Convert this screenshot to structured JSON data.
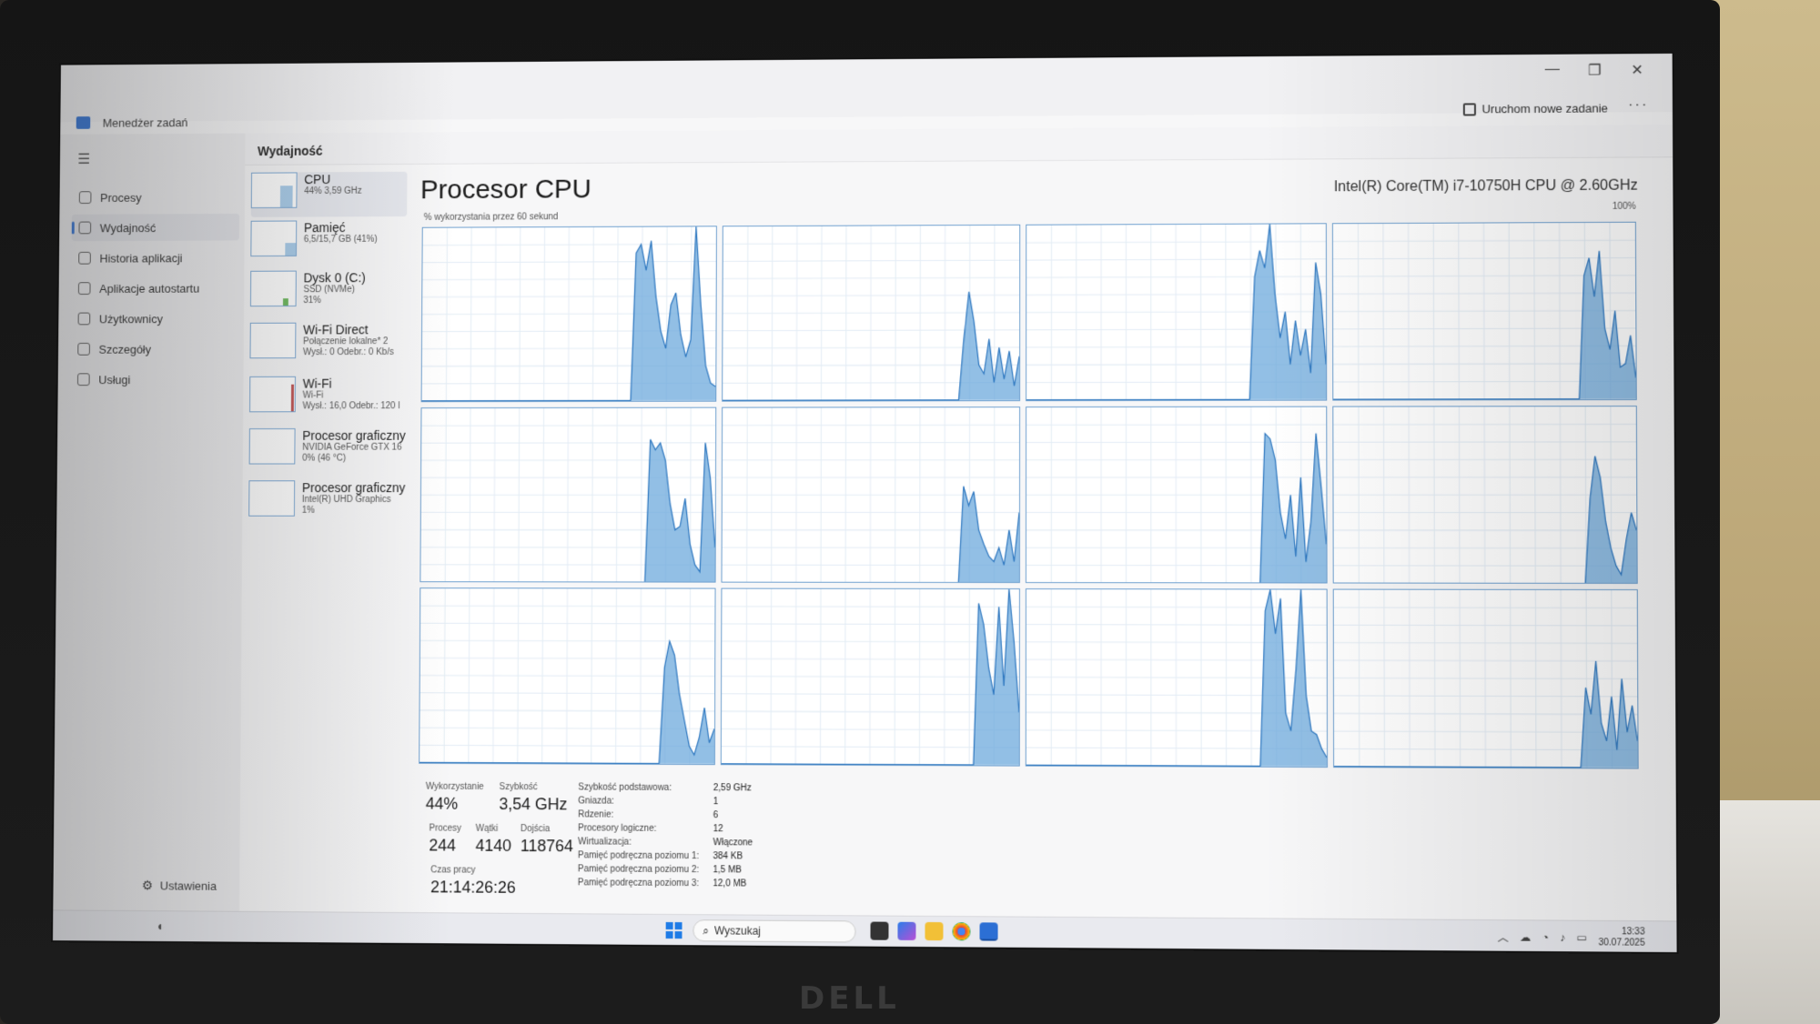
{
  "window": {
    "title": "Menedżer zadań",
    "run_new_task": "Uruchom nowe zadanie",
    "more": "···"
  },
  "nav": {
    "items": [
      {
        "label": "Procesy",
        "icon": "processes-icon",
        "active": false
      },
      {
        "label": "Wydajność",
        "icon": "performance-icon",
        "active": true
      },
      {
        "label": "Historia aplikacji",
        "icon": "history-icon",
        "active": false
      },
      {
        "label": "Aplikacje autostartu",
        "icon": "startup-icon",
        "active": false
      },
      {
        "label": "Użytkownicy",
        "icon": "users-icon",
        "active": false
      },
      {
        "label": "Szczegóły",
        "icon": "details-icon",
        "active": false
      },
      {
        "label": "Usługi",
        "icon": "services-icon",
        "active": false
      }
    ],
    "settings": "Ustawienia"
  },
  "page": {
    "title": "Wydajność"
  },
  "devices": [
    {
      "name": "CPU",
      "sub1": "44% 3,59 GHz",
      "sub2": "",
      "sub3": "",
      "active": true
    },
    {
      "name": "Pamięć",
      "sub1": "6,5/15,7 GB (41%)",
      "sub2": "",
      "sub3": "",
      "active": false
    },
    {
      "name": "Dysk 0 (C:)",
      "sub1": "SSD (NVMe)",
      "sub2": "31%",
      "sub3": "",
      "active": false
    },
    {
      "name": "Wi-Fi Direct",
      "sub1": "Połączenie lokalne* 2",
      "sub2": "Wysł.: 0 Odebr.: 0 Kb/s",
      "sub3": "",
      "active": false
    },
    {
      "name": "Wi-Fi",
      "sub1": "Wi-Fi",
      "sub2": "Wysł.: 16,0 Odebr.: 120 l",
      "sub3": "",
      "active": false
    },
    {
      "name": "Procesor graficzny",
      "sub1": "NVIDIA GeForce GTX 16",
      "sub2": "0% (46 °C)",
      "sub3": "",
      "active": false
    },
    {
      "name": "Procesor graficzny",
      "sub1": "Intel(R) UHD Graphics",
      "sub2": "1%",
      "sub3": "",
      "active": false
    }
  ],
  "cpu": {
    "title": "Procesor CPU",
    "model": "Intel(R) Core(TM) i7-10750H CPU @ 2.60GHz",
    "chart_label": "% wykorzystania przez 60 sekund",
    "chart_max": "100%",
    "stats": {
      "usage_label": "Wykorzystanie",
      "usage": "44%",
      "speed_label": "Szybkość",
      "speed": "3,54 GHz",
      "processes_label": "Procesy",
      "processes": "244",
      "threads_label": "Wątki",
      "threads": "4140",
      "handles_label": "Dojścia",
      "handles": "118764",
      "uptime_label": "Czas pracy",
      "uptime": "21:14:26:26"
    },
    "info": [
      {
        "key": "Szybkość podstawowa:",
        "value": "2,59 GHz"
      },
      {
        "key": "Gniazda:",
        "value": "1"
      },
      {
        "key": "Rdzenie:",
        "value": "6"
      },
      {
        "key": "Procesory logiczne:",
        "value": "12"
      },
      {
        "key": "Wirtualizacja:",
        "value": "Włączone"
      },
      {
        "key": "Pamięć podręczna poziomu 1:",
        "value": "384 KB"
      },
      {
        "key": "Pamięć podręczna poziomu 2:",
        "value": "1,5 MB"
      },
      {
        "key": "Pamięć podręczna poziomu 3:",
        "value": "12,0 MB"
      }
    ]
  },
  "chart_data": {
    "type": "area",
    "title": "",
    "xlabel": "",
    "ylabel": "% wykorzystania przez 60 sekund",
    "ylim": [
      0,
      100
    ],
    "xlim": [
      0,
      60
    ],
    "grid": true,
    "series": [
      {
        "values": [
          0,
          0,
          0,
          0,
          0,
          0,
          0,
          0,
          0,
          0,
          0,
          0,
          0,
          0,
          0,
          0,
          0,
          0,
          0,
          0,
          0,
          0,
          0,
          0,
          0,
          0,
          0,
          0,
          0,
          0,
          0,
          0,
          0,
          0,
          0,
          0,
          0,
          0,
          0,
          0,
          0,
          0,
          0,
          85,
          90,
          75,
          92,
          60,
          40,
          30,
          55,
          62,
          38,
          25,
          35,
          100,
          55,
          20,
          10,
          8
        ]
      },
      {
        "values": [
          0,
          0,
          0,
          0,
          0,
          0,
          0,
          0,
          0,
          0,
          0,
          0,
          0,
          0,
          0,
          0,
          0,
          0,
          0,
          0,
          0,
          0,
          0,
          0,
          0,
          0,
          0,
          0,
          0,
          0,
          0,
          0,
          0,
          0,
          0,
          0,
          0,
          0,
          0,
          0,
          0,
          0,
          0,
          0,
          0,
          0,
          0,
          0,
          35,
          62,
          45,
          20,
          15,
          35,
          10,
          30,
          12,
          28,
          8,
          25
        ]
      },
      {
        "values": [
          0,
          0,
          0,
          0,
          0,
          0,
          0,
          0,
          0,
          0,
          0,
          0,
          0,
          0,
          0,
          0,
          0,
          0,
          0,
          0,
          0,
          0,
          0,
          0,
          0,
          0,
          0,
          0,
          0,
          0,
          0,
          0,
          0,
          0,
          0,
          0,
          0,
          0,
          0,
          0,
          0,
          0,
          0,
          0,
          0,
          70,
          85,
          75,
          100,
          60,
          35,
          50,
          20,
          45,
          25,
          40,
          15,
          78,
          60,
          20
        ]
      },
      {
        "values": [
          0,
          0,
          0,
          0,
          0,
          0,
          0,
          0,
          0,
          0,
          0,
          0,
          0,
          0,
          0,
          0,
          0,
          0,
          0,
          0,
          0,
          0,
          0,
          0,
          0,
          0,
          0,
          0,
          0,
          0,
          0,
          0,
          0,
          0,
          0,
          0,
          0,
          0,
          0,
          0,
          0,
          0,
          0,
          0,
          0,
          0,
          0,
          0,
          0,
          70,
          80,
          58,
          84,
          40,
          28,
          50,
          18,
          20,
          36,
          12
        ]
      },
      {
        "values": [
          0,
          0,
          0,
          0,
          0,
          0,
          0,
          0,
          0,
          0,
          0,
          0,
          0,
          0,
          0,
          0,
          0,
          0,
          0,
          0,
          0,
          0,
          0,
          0,
          0,
          0,
          0,
          0,
          0,
          0,
          0,
          0,
          0,
          0,
          0,
          0,
          0,
          0,
          0,
          0,
          0,
          0,
          0,
          0,
          0,
          0,
          82,
          76,
          80,
          70,
          45,
          30,
          32,
          48,
          22,
          10,
          6,
          80,
          60,
          20
        ]
      },
      {
        "values": [
          0,
          0,
          0,
          0,
          0,
          0,
          0,
          0,
          0,
          0,
          0,
          0,
          0,
          0,
          0,
          0,
          0,
          0,
          0,
          0,
          0,
          0,
          0,
          0,
          0,
          0,
          0,
          0,
          0,
          0,
          0,
          0,
          0,
          0,
          0,
          0,
          0,
          0,
          0,
          0,
          0,
          0,
          0,
          0,
          0,
          0,
          0,
          0,
          55,
          44,
          52,
          30,
          22,
          15,
          12,
          20,
          10,
          30,
          12,
          40
        ]
      },
      {
        "values": [
          0,
          0,
          0,
          0,
          0,
          0,
          0,
          0,
          0,
          0,
          0,
          0,
          0,
          0,
          0,
          0,
          0,
          0,
          0,
          0,
          0,
          0,
          0,
          0,
          0,
          0,
          0,
          0,
          0,
          0,
          0,
          0,
          0,
          0,
          0,
          0,
          0,
          0,
          0,
          0,
          0,
          0,
          0,
          0,
          0,
          0,
          0,
          85,
          82,
          70,
          40,
          25,
          50,
          15,
          60,
          12,
          35,
          85,
          55,
          22
        ]
      },
      {
        "values": [
          0,
          0,
          0,
          0,
          0,
          0,
          0,
          0,
          0,
          0,
          0,
          0,
          0,
          0,
          0,
          0,
          0,
          0,
          0,
          0,
          0,
          0,
          0,
          0,
          0,
          0,
          0,
          0,
          0,
          0,
          0,
          0,
          0,
          0,
          0,
          0,
          0,
          0,
          0,
          0,
          0,
          0,
          0,
          0,
          0,
          0,
          0,
          0,
          0,
          0,
          48,
          72,
          60,
          35,
          20,
          10,
          5,
          25,
          40,
          30
        ]
      },
      {
        "values": [
          0,
          0,
          0,
          0,
          0,
          0,
          0,
          0,
          0,
          0,
          0,
          0,
          0,
          0,
          0,
          0,
          0,
          0,
          0,
          0,
          0,
          0,
          0,
          0,
          0,
          0,
          0,
          0,
          0,
          0,
          0,
          0,
          0,
          0,
          0,
          0,
          0,
          0,
          0,
          0,
          0,
          0,
          0,
          0,
          0,
          0,
          0,
          0,
          0,
          55,
          70,
          62,
          40,
          25,
          10,
          5,
          15,
          32,
          12,
          20
        ]
      },
      {
        "values": [
          0,
          0,
          0,
          0,
          0,
          0,
          0,
          0,
          0,
          0,
          0,
          0,
          0,
          0,
          0,
          0,
          0,
          0,
          0,
          0,
          0,
          0,
          0,
          0,
          0,
          0,
          0,
          0,
          0,
          0,
          0,
          0,
          0,
          0,
          0,
          0,
          0,
          0,
          0,
          0,
          0,
          0,
          0,
          0,
          0,
          0,
          0,
          0,
          0,
          0,
          0,
          92,
          80,
          55,
          40,
          90,
          45,
          100,
          70,
          30
        ]
      },
      {
        "values": [
          0,
          0,
          0,
          0,
          0,
          0,
          0,
          0,
          0,
          0,
          0,
          0,
          0,
          0,
          0,
          0,
          0,
          0,
          0,
          0,
          0,
          0,
          0,
          0,
          0,
          0,
          0,
          0,
          0,
          0,
          0,
          0,
          0,
          0,
          0,
          0,
          0,
          0,
          0,
          0,
          0,
          0,
          0,
          0,
          0,
          0,
          0,
          88,
          100,
          75,
          95,
          30,
          20,
          55,
          100,
          40,
          20,
          18,
          10,
          5
        ]
      },
      {
        "values": [
          0,
          0,
          0,
          0,
          0,
          0,
          0,
          0,
          0,
          0,
          0,
          0,
          0,
          0,
          0,
          0,
          0,
          0,
          0,
          0,
          0,
          0,
          0,
          0,
          0,
          0,
          0,
          0,
          0,
          0,
          0,
          0,
          0,
          0,
          0,
          0,
          0,
          0,
          0,
          0,
          0,
          0,
          0,
          0,
          0,
          0,
          0,
          0,
          0,
          45,
          30,
          60,
          25,
          15,
          40,
          10,
          50,
          20,
          35,
          15
        ]
      }
    ]
  },
  "taskbar": {
    "search_placeholder": "Wyszukaj",
    "time": "13:33",
    "date": "30.07.2025"
  },
  "brand": "DELL"
}
